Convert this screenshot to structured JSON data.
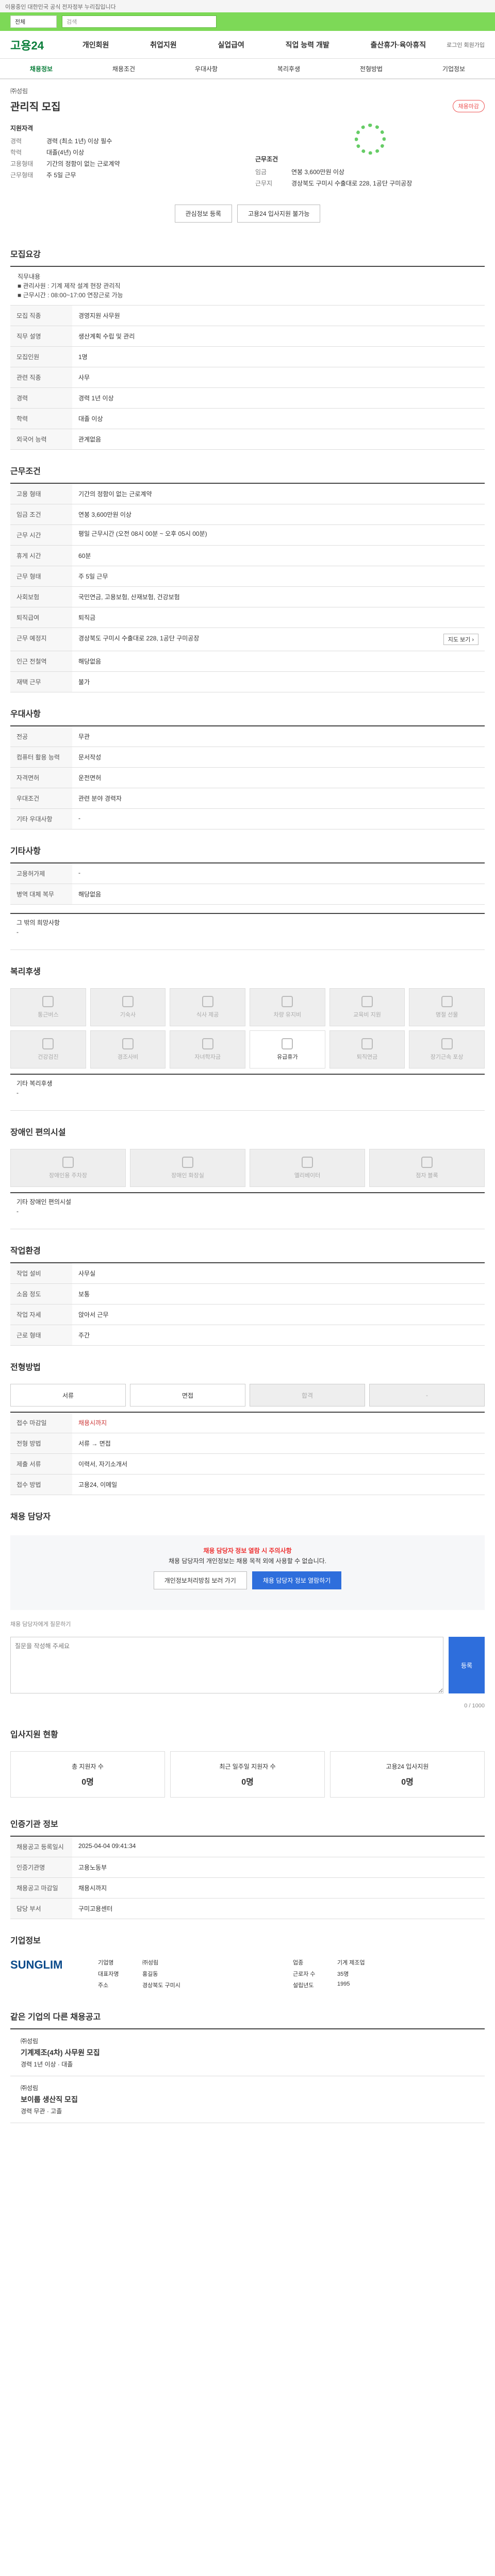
{
  "topbar": {
    "text": "이용중인 대한민국 공식 전자정부 누리집입니다"
  },
  "search": {
    "scope": "전체",
    "placeholder": "검색"
  },
  "header": {
    "logo": "고용24",
    "nav": [
      "개인회원",
      "취업지원",
      "실업급여",
      "직업 능력 개발",
      "출산휴가·육아휴직"
    ],
    "right": "로그인 회원가입"
  },
  "subnav": [
    "채용정보",
    "채용조건",
    "우대사항",
    "복리후생",
    "전형방법",
    "기업정보"
  ],
  "job": {
    "company": "㈜성림",
    "title": "관리직 모집",
    "badge": "채용마감",
    "summary": {
      "left_title": "지원자격",
      "exp_label": "경력",
      "exp": "경력 (최소 1년) 이상 필수",
      "edu_label": "학력",
      "edu": "대졸(4년) 이상",
      "type_label": "고용형태",
      "type": "기간의 정함이 없는 근로계약",
      "pay_label": "근무형태",
      "pay": "주 5일 근무",
      "right_title": "근무조건",
      "wage_label": "임금",
      "wage": "연봉 3,600만원 이상",
      "loc_label": "근무지",
      "loc": "경상북도 구미시 수출대로 228, 1공단 구미공장"
    },
    "buttons": {
      "save": "관심정보 등록",
      "share": "고용24 입사지원 불가능"
    }
  },
  "recruit": {
    "title": "모집요강",
    "note": "직무내용\n■ 관리사원 : 기계 제작 설계 현장 관리직\n■ 근무시간 : 08:00~17:00 연장근로 가능",
    "rows": [
      [
        "모집 직종",
        "경영지원 사무원"
      ],
      [
        "직무 설명",
        "생산계획 수립 및 관리"
      ],
      [
        "모집인원",
        "1명"
      ],
      [
        "관련 직종",
        "사무"
      ],
      [
        "경력",
        "경력 1년 이상"
      ],
      [
        "학력",
        "대졸 이상"
      ],
      [
        "외국어 능력",
        "관계없음"
      ]
    ]
  },
  "conditions": {
    "title": "근무조건",
    "rows": [
      [
        "고용 형태",
        "기간의 정함이 없는 근로계약"
      ],
      [
        "임금 조건",
        "연봉 3,600만원 이상"
      ],
      [
        "근무 시간",
        "평일 근무시간 (오전 08시 00분 ~ 오후 05시 00분)"
      ],
      [
        "휴게 시간",
        "60분"
      ],
      [
        "근무 형태",
        "주 5일 근무"
      ],
      [
        "사회보험",
        "국민연금, 고용보험, 산재보험, 건강보험"
      ],
      [
        "퇴직급여",
        "퇴직금"
      ],
      [
        "근무 예정지",
        "경상북도 구미시 수출대로 228, 1공단 구미공장"
      ],
      [
        "인근 전철역",
        "해당없음"
      ],
      [
        "재택 근무",
        "불가"
      ]
    ],
    "map_button": "지도 보기 ›"
  },
  "preferences": {
    "title": "우대사항",
    "rows": [
      [
        "전공",
        "무관"
      ],
      [
        "컴퓨터 활용 능력",
        "문서작성"
      ],
      [
        "자격면허",
        "운전면허"
      ],
      [
        "우대조건",
        "관련 분야 경력자"
      ],
      [
        "기타 우대사항",
        "-"
      ]
    ]
  },
  "other": {
    "title": "기타사항",
    "rows": [
      [
        "고용허가제",
        "-"
      ],
      [
        "병역 대체 복무",
        "해당없음"
      ]
    ]
  },
  "etc": {
    "label": "그 밖의 희망사항",
    "value": "-"
  },
  "welfare": {
    "title": "복리후생",
    "items": [
      "통근버스",
      "기숙사",
      "식사 제공",
      "차량 유지비",
      "교육비 지원",
      "명절 선물",
      "건강검진",
      "경조사비",
      "자녀학자금",
      "유급휴가",
      "퇴직연금",
      "장기근속 포상"
    ],
    "extra_label": "기타 복리후생",
    "extra_value": "-"
  },
  "disability": {
    "title": "장애인 편의시설",
    "items": [
      "장애인용 주차장",
      "장애인 화장실",
      "엘리베이터",
      "점자 블록"
    ],
    "extra_label": "기타 장애인 편의시설",
    "extra_value": "-"
  },
  "work_env": {
    "title": "작업환경",
    "rows": [
      [
        "작업 설비",
        "사무실"
      ],
      [
        "소음 정도",
        "보통"
      ],
      [
        "작업 자세",
        "앉아서 근무"
      ],
      [
        "근로 형태",
        "주간"
      ]
    ]
  },
  "process": {
    "title": "전형방법",
    "steps": [
      "서류",
      "면접",
      "합격",
      "-"
    ],
    "rows": [
      [
        "접수 마감일",
        "채용시까지"
      ],
      [
        "전형 방법",
        "서류 → 면접"
      ],
      [
        "제출 서류",
        "이력서, 자기소개서"
      ],
      [
        "접수 방법",
        "고용24, 이메일"
      ]
    ]
  },
  "contact": {
    "title": "채용 담당자",
    "alert": "채용 담당자 정보 열람 시 주의사항",
    "text": "채용 담당자의 개인정보는 채용 목적 외에 사용할 수 없습니다.",
    "btn1": "개인정보처리방침 보러 가기",
    "btn2": "채용 담당자 정보 열람하기"
  },
  "inquiry": {
    "title": "채용 담당자에게 질문하기",
    "placeholder": "질문을 작성해 주세요",
    "count": "0 / 1000",
    "submit": "등록"
  },
  "applicants": {
    "title": "입사지원 현황",
    "stats": [
      [
        "총 지원자 수",
        "0명"
      ],
      [
        "최근 일주일 지원자 수",
        "0명"
      ],
      [
        "고용24 입사지원",
        "0명"
      ]
    ]
  },
  "info": {
    "title": "인증기관 정보",
    "rows": [
      [
        "채용공고 등록일시",
        "2025-04-04 09:41:34"
      ],
      [
        "인증기관명",
        "고용노동부"
      ],
      [
        "채용공고 마감일",
        "채용시까지"
      ],
      [
        "담당 부서",
        "구미고용센터"
      ]
    ]
  },
  "corp": {
    "title": "기업정보",
    "logo": "SUNGLIM",
    "name": "㈜성림",
    "grid": [
      [
        "기업명",
        "㈜성림"
      ],
      [
        "업종",
        "기계 제조업"
      ],
      [
        "대표자명",
        "홍길동"
      ],
      [
        "근로자 수",
        "35명"
      ],
      [
        "주소",
        "경상북도 구미시"
      ],
      [
        "설립년도",
        "1995"
      ]
    ]
  },
  "others": {
    "title": "같은 기업의 다른 채용공고",
    "items": [
      {
        "co": "㈜성림",
        "title": "기계제조(4차) 사무원 모집",
        "meta": "경력 1년 이상 · 대졸"
      },
      {
        "co": "㈜성림",
        "title": "보이룹 생산직 모집",
        "meta": "경력 무관 · 고졸"
      }
    ]
  }
}
